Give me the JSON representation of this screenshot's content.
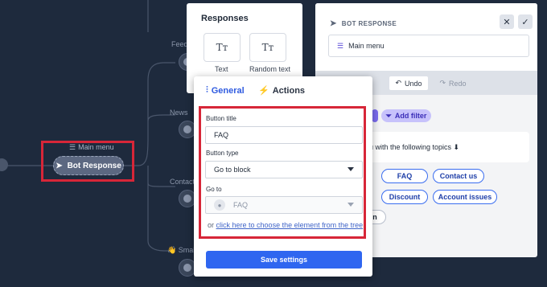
{
  "canvas": {
    "node_labels": {
      "feed": "Feed",
      "news": "News",
      "contact": "Contact",
      "small": "Small"
    },
    "main_menu_label": "Main menu",
    "bot_response_label": "Bot Response",
    "colors": {
      "highlight": "#d72638",
      "canvas_bg": "#1e2a3d"
    }
  },
  "responses": {
    "title": "Responses",
    "items": [
      {
        "label": "Text",
        "icon": "text-icon"
      },
      {
        "label": "Random text",
        "icon": "random-text-icon"
      }
    ]
  },
  "bot_panel": {
    "title": "BOT RESPONSE",
    "name_value": "Main menu",
    "undo_label": "Undo",
    "redo_label": "Redo",
    "filter_label": "Add filter",
    "message_text": "ou with the following topics ⬇",
    "chips": [
      "FAQ",
      "Contact us",
      "Discount",
      "Account issues",
      "n"
    ]
  },
  "settings": {
    "tabs": {
      "general": "General",
      "actions": "Actions"
    },
    "button_title_label": "Button title",
    "button_title_value": "FAQ",
    "button_type_label": "Button type",
    "button_type_value": "Go to block",
    "goto_label": "Go to",
    "goto_value": "FAQ",
    "tree_prefix": "or",
    "tree_link": "click here to choose the element from the tree",
    "save_label": "Save settings",
    "accent": "#2f66f0"
  }
}
